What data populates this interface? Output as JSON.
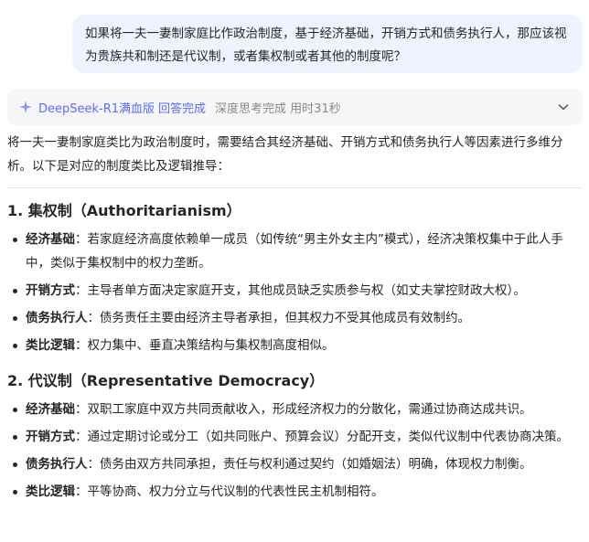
{
  "user_message": {
    "text": "如果将一夫一妻制家庭比作政治制度，基于经济基础，开销方式和债务执行人，那应该视为贵族共和制还是代议制，或者集权制或者其他的制度呢？"
  },
  "status": {
    "icon": "sparkle-icon",
    "model": "DeepSeek-R1满血版",
    "done": "回答完成",
    "thinking": "深度思考完成 用时31秒",
    "toggle_icon": "chevron-down-icon"
  },
  "answer": {
    "intro": "将一夫一妻制家庭类比为政治制度时，需要结合其经济基础、开销方式和债务执行人等因素进行多维分析。以下是对应的制度类比及逻辑推导：",
    "sections": [
      {
        "title": "1. 集权制（Authoritarianism）",
        "items": [
          {
            "label": "经济基础",
            "text": "：若家庭经济高度依赖单一成员（如传统“男主外女主内”模式），经济决策权集中于此人手中，类似于集权制中的权力垄断。"
          },
          {
            "label": "开销方式",
            "text": "：主导者单方面决定家庭开支，其他成员缺乏实质参与权（如丈夫掌控财政大权）。"
          },
          {
            "label": "债务执行人",
            "text": "：债务责任主要由经济主导者承担，但其权力不受其他成员有效制约。"
          },
          {
            "label": "类比逻辑",
            "text": "：权力集中、垂直决策结构与集权制高度相似。"
          }
        ]
      },
      {
        "title": "2. 代议制（Representative Democracy）",
        "items": [
          {
            "label": "经济基础",
            "text": "：双职工家庭中双方共同贡献收入，形成经济权力的分散化，需通过协商达成共识。"
          },
          {
            "label": "开销方式",
            "text": "：通过定期讨论或分工（如共同账户、预算会议）分配开支，类似代议制中代表协商决策。"
          },
          {
            "label": "债务执行人",
            "text": "：债务由双方共同承担，责任与权利通过契约（如婚姻法）明确，体现权力制衡。"
          },
          {
            "label": "类比逻辑",
            "text": "：平等协商、权力分立与代议制的代表性民主机制相符。"
          }
        ]
      }
    ]
  },
  "colors": {
    "bubble_bg": "#eff2ff",
    "accent": "#5b6cf6",
    "muted": "#8a8a8a",
    "status_bg": "#f6f6f8"
  }
}
